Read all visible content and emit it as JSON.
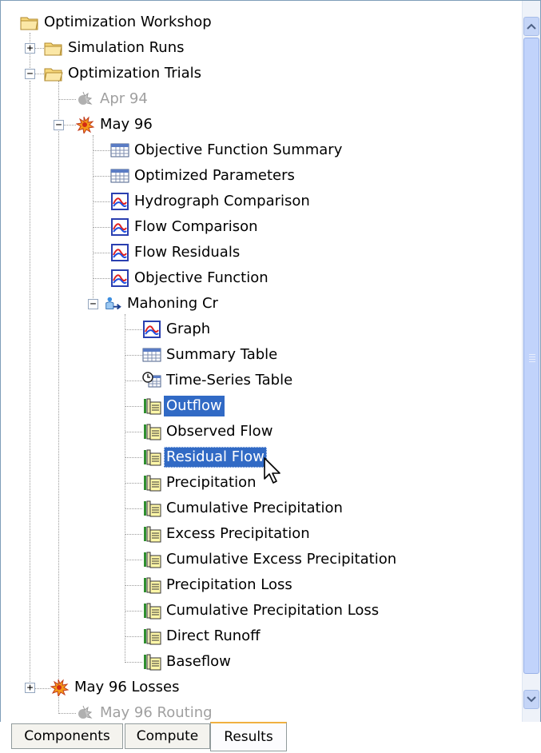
{
  "tree": {
    "root": "Optimization Workshop",
    "simulation_runs": "Simulation Runs",
    "optimization_trials": "Optimization Trials",
    "trial_apr94": "Apr 94",
    "trial_may96": "May 96",
    "may96_children": [
      "Objective Function Summary",
      "Optimized Parameters",
      "Hydrograph Comparison",
      "Flow Comparison",
      "Flow Residuals",
      "Objective Function"
    ],
    "element": "Mahoning Cr",
    "element_children": [
      "Graph",
      "Summary Table",
      "Time-Series Table",
      "Outflow",
      "Observed Flow",
      "Residual Flow",
      "Precipitation",
      "Cumulative Precipitation",
      "Excess Precipitation",
      "Cumulative Excess Precipitation",
      "Precipitation Loss",
      "Cumulative Precipitation Loss",
      "Direct Runoff",
      "Baseflow"
    ],
    "trial_may96_losses": "May 96 Losses",
    "trial_may96_routing": "May 96 Routing"
  },
  "tabs": [
    "Components",
    "Compute",
    "Results"
  ],
  "active_tab": "Results",
  "colors": {
    "selection": "#316ac5",
    "border": "#7f9db9"
  }
}
